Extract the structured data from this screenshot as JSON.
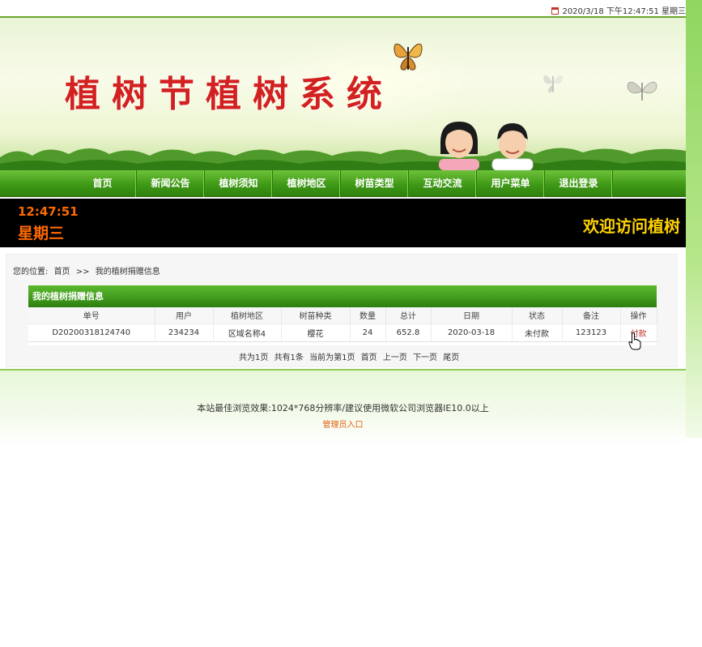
{
  "topbar": {
    "datetime": "2020/3/18 下午12:47:51 星期三",
    "icon": "calendar-icon"
  },
  "banner": {
    "title": "植树节植树系统"
  },
  "nav": {
    "items": [
      {
        "label": "首页"
      },
      {
        "label": "新闻公告"
      },
      {
        "label": "植树须知"
      },
      {
        "label": "植树地区"
      },
      {
        "label": "树苗类型"
      },
      {
        "label": "互动交流"
      },
      {
        "label": "用户菜单"
      },
      {
        "label": "退出登录"
      }
    ]
  },
  "clockbar": {
    "time": "12:47:51",
    "weekday": "星期三",
    "marquee": "欢迎访问植树"
  },
  "breadcrumb": {
    "prefix": "您的位置:",
    "home": "首页",
    "sep": ">>",
    "current": "我的植树捐赠信息"
  },
  "panel": {
    "title": "我的植树捐赠信息",
    "columns": [
      "单号",
      "用户",
      "植树地区",
      "树苗种类",
      "数量",
      "总计",
      "日期",
      "状态",
      "备注",
      "操作"
    ],
    "rows": [
      {
        "order_no": "D20200318124740",
        "user": "234234",
        "area": "区域名称4",
        "tree": "樱花",
        "qty": "24",
        "total": "652.8",
        "date": "2020-03-18",
        "status": "未付款",
        "remark": "123123",
        "action": "付款"
      }
    ]
  },
  "pager": {
    "total_pages": "共为1页",
    "total_items": "共有1条",
    "current": "当前为第1页",
    "first": "首页",
    "prev": "上一页",
    "next": "下一页",
    "last": "尾页"
  },
  "footer": {
    "note": "本站最佳浏览效果:1024*768分辨率/建议使用微软公司浏览器IE10.0以上",
    "admin_link": "管理员入口"
  },
  "colors": {
    "nav_green": "#3f9a17",
    "title_red": "#d32020",
    "clock_orange": "#ff6a00",
    "marquee_yellow": "#ffd200"
  }
}
